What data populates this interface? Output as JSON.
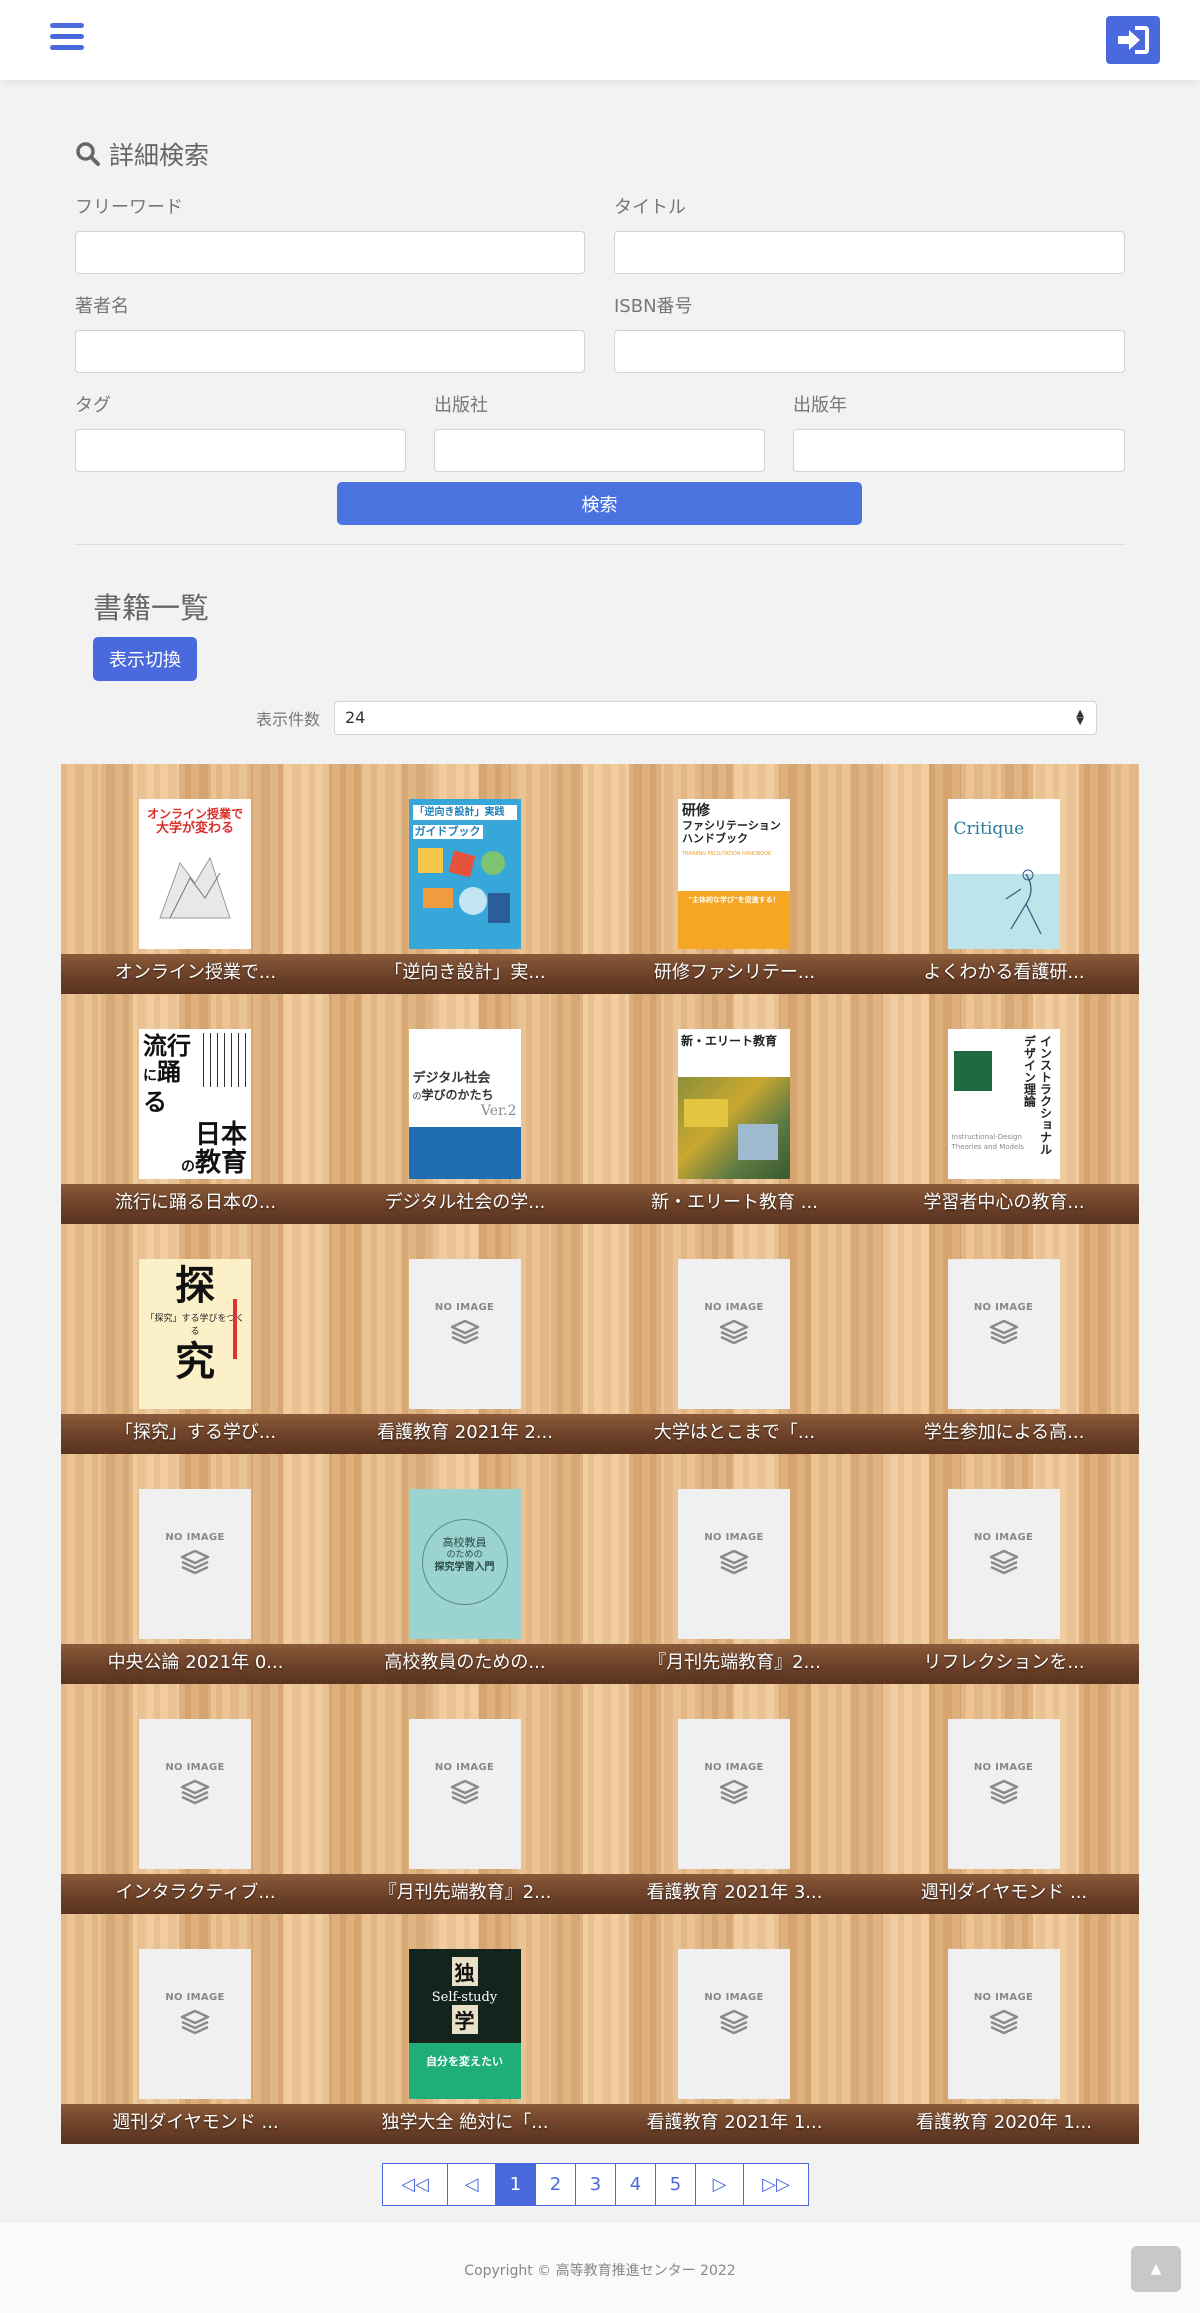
{
  "header": {
    "menu_icon": "hamburger-icon",
    "login_icon": "sign-in-icon"
  },
  "search": {
    "title": "詳細検索",
    "freeword_label": "フリーワード",
    "title_label": "タイトル",
    "author_label": "著者名",
    "isbn_label": "ISBN番号",
    "tag_label": "タグ",
    "publisher_label": "出版社",
    "year_label": "出版年",
    "submit_label": "検索"
  },
  "book_list": {
    "title": "書籍一覧",
    "toggle_label": "表示切換",
    "count_label": "表示件数",
    "count_value": "24",
    "no_image_text": "NO IMAGE",
    "books": [
      {
        "title": "オンライン授業で...",
        "cover": "online"
      },
      {
        "title": "「逆向き設計」実...",
        "cover": "gyakumuki"
      },
      {
        "title": "研修ファシリテー...",
        "cover": "kenshu"
      },
      {
        "title": "よくわかる看護研...",
        "cover": "critique"
      },
      {
        "title": "流行に踊る日本の...",
        "cover": "ryuko"
      },
      {
        "title": "デジタル社会の学...",
        "cover": "digital"
      },
      {
        "title": "新・エリート教育 ...",
        "cover": "elite"
      },
      {
        "title": "学習者中心の教育...",
        "cover": "instructional"
      },
      {
        "title": "「探究」する学び...",
        "cover": "tankyu"
      },
      {
        "title": "看護教育 2021年 2...",
        "cover": "none"
      },
      {
        "title": "大学はとこまで「...",
        "cover": "none"
      },
      {
        "title": "学生参加による高...",
        "cover": "none"
      },
      {
        "title": "中央公論 2021年 0...",
        "cover": "none"
      },
      {
        "title": "高校教員のための...",
        "cover": "koko"
      },
      {
        "title": "『月刊先端教育』2...",
        "cover": "none"
      },
      {
        "title": "リフレクションを...",
        "cover": "none"
      },
      {
        "title": "インタラクティブ...",
        "cover": "none"
      },
      {
        "title": "『月刊先端教育』2...",
        "cover": "none"
      },
      {
        "title": "看護教育 2021年 3...",
        "cover": "none"
      },
      {
        "title": "週刊ダイヤモンド ...",
        "cover": "none"
      },
      {
        "title": "週刊ダイヤモンド ...",
        "cover": "none"
      },
      {
        "title": "独学大全 絶対に「...",
        "cover": "dokugaku"
      },
      {
        "title": "看護教育 2021年 1...",
        "cover": "none"
      },
      {
        "title": "看護教育 2020年 1...",
        "cover": "none"
      }
    ],
    "cover_texts": {
      "online": [
        "オンライン授業で",
        "大学が変わる"
      ],
      "gyakumuki": [
        "「逆向き設計」実践",
        "ガイドブック"
      ],
      "kenshu": [
        "研修",
        "ファシリテーション",
        "ハンドブック",
        "TRAINING FACILITATION HANDBOOK",
        "\"主体的な学び\"を促進する！"
      ],
      "critique": [
        "Critique"
      ],
      "ryuko": [
        "流行",
        "に",
        "踊る",
        "日本",
        "の",
        "教育"
      ],
      "digital": [
        "デジタル社会",
        "の",
        "学びのかたち",
        "Ver.2"
      ],
      "elite": [
        "新・エリート教育"
      ],
      "instructional": [
        "インストラクショナル",
        "デザイン理論",
        "Instructional-Design",
        "Theories and Models"
      ],
      "tankyu": [
        "探",
        "究",
        "「探究」する学びをつくる"
      ],
      "koko": [
        "高校教員",
        "のための",
        "探究学習入門"
      ],
      "dokugaku": [
        "独",
        "学",
        "Self-study",
        "自分を変えたい"
      ]
    }
  },
  "pagination": {
    "first": "◁◁",
    "prev": "◁",
    "pages": [
      "1",
      "2",
      "3",
      "4",
      "5"
    ],
    "next": "▷",
    "last": "▷▷",
    "current": "1"
  },
  "footer": {
    "copyright": "Copyright © 高等教育推進センター 2022",
    "top_icon": "arrow-up-icon"
  }
}
